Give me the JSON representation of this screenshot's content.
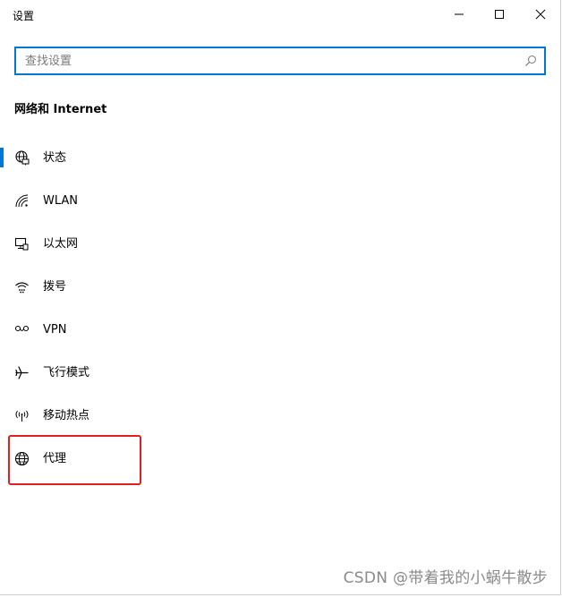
{
  "window": {
    "title": "设置"
  },
  "title_buttons": {
    "minimize": "minimize-icon",
    "maximize": "maximize-icon",
    "close": "close-icon"
  },
  "search": {
    "placeholder": "查找设置",
    "value": "",
    "icon": "search-icon"
  },
  "section": {
    "title": "网络和 Internet"
  },
  "nav": {
    "items": [
      {
        "label": "状态",
        "icon": "globe-status-icon",
        "selected": true
      },
      {
        "label": "WLAN",
        "icon": "wifi-icon",
        "selected": false
      },
      {
        "label": "以太网",
        "icon": "ethernet-icon",
        "selected": false
      },
      {
        "label": "拨号",
        "icon": "dialup-icon",
        "selected": false
      },
      {
        "label": "VPN",
        "icon": "vpn-icon",
        "selected": false
      },
      {
        "label": "飞行模式",
        "icon": "airplane-icon",
        "selected": false
      },
      {
        "label": "移动热点",
        "icon": "hotspot-icon",
        "selected": false
      },
      {
        "label": "代理",
        "icon": "globe-proxy-icon",
        "selected": false,
        "highlighted": true
      }
    ]
  },
  "colors": {
    "accent": "#0078d7",
    "highlight": "#e02020",
    "watermark": "#8a8a8a"
  },
  "watermark": "CSDN @带着我的小蜗牛散步"
}
